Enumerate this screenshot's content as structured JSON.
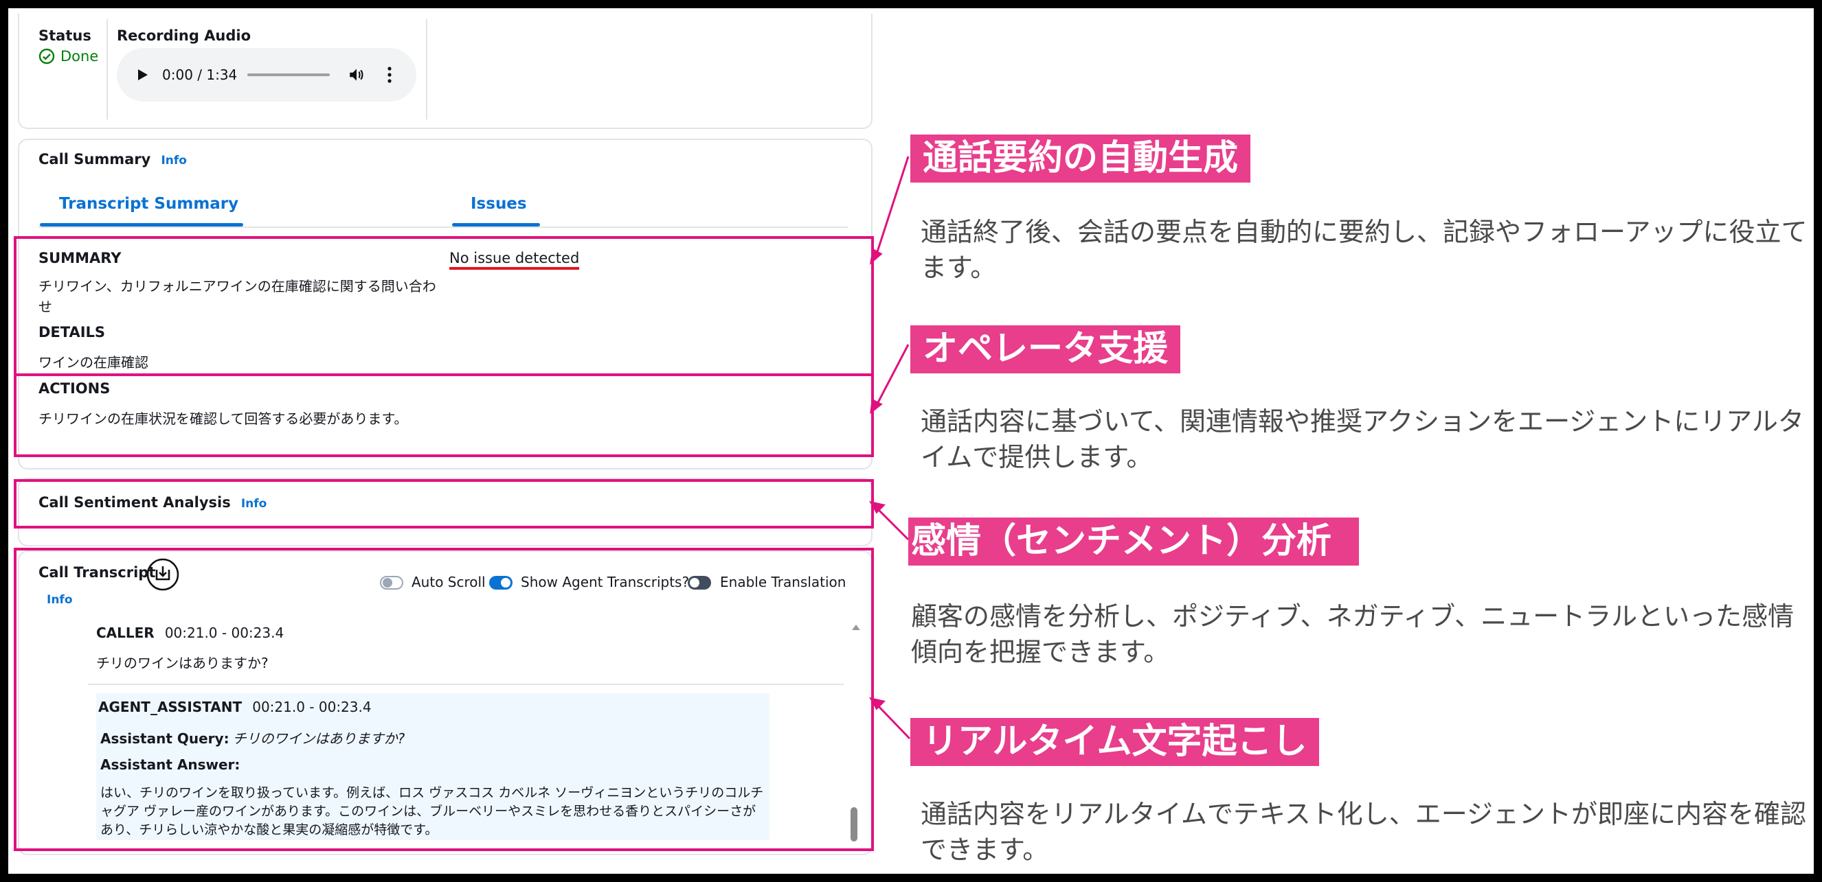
{
  "status": {
    "label": "Status",
    "value": "Done"
  },
  "recording": {
    "label": "Recording Audio",
    "time": "0:00 / 1:34"
  },
  "call_summary": {
    "title": "Call Summary",
    "info": "Info",
    "tabs": [
      "Transcript Summary",
      "Issues"
    ],
    "summary_label": "SUMMARY",
    "summary_text": "チリワイン、カリフォルニアワインの在庫確認に関する問い合わせ",
    "details_label": "DETAILS",
    "details_text": "ワインの在庫確認",
    "actions_label": "ACTIONS",
    "actions_text": "チリワインの在庫状況を確認して回答する必要があります。",
    "issues_text": "No issue detected"
  },
  "sentiment": {
    "title": "Call Sentiment Analysis",
    "info": "Info"
  },
  "transcript": {
    "title": "Call Transcript",
    "info": "Info",
    "toggles": [
      "Auto Scroll",
      "Show Agent Transcripts?",
      "Enable Translation"
    ],
    "caller": {
      "speaker": "CALLER",
      "time": "00:21.0 - 00:23.4",
      "text": "チリのワインはありますか?"
    },
    "agent": {
      "speaker": "AGENT_ASSISTANT",
      "time": "00:21.0 - 00:23.4",
      "query_label": "Assistant Query:",
      "query_text": "チリのワインはありますか?",
      "answer_label": "Assistant Answer:",
      "answer_text": "はい、チリのワインを取り扱っています。例えば、ロス ヴァスコス カベルネ ソーヴィニヨンというチリのコルチャグア ヴァレー産のワインがあります。このワインは、ブルーベリーやスミレを思わせる香りとスパイシーさがあり、チリらしい涼やかな酸と果実の凝縮感が特徴です。"
    }
  },
  "annotations": [
    {
      "tag": "通話要約の自動生成",
      "desc": "通話終了後、会話の要点を自動的に要約し、記録やフォローアップに役立てます。"
    },
    {
      "tag": "オペレータ支援",
      "desc": "通話内容に基づいて、関連情報や推奨アクションをエージェントにリアルタイムで提供します。"
    },
    {
      "tag": "感情（センチメント）分析",
      "desc": "顧客の感情を分析し、ポジティブ、ネガティブ、ニュートラルといった感情傾向を把握できます。"
    },
    {
      "tag": "リアルタイム文字起こし",
      "desc": "通話内容をリアルタイムでテキスト化し、エージェントが即座に内容を確認できます。"
    }
  ],
  "colors": {
    "accent": "#0972d3",
    "highlight": "#e0117f",
    "tag_bg": "#e83e8c",
    "done": "#037f0c"
  }
}
